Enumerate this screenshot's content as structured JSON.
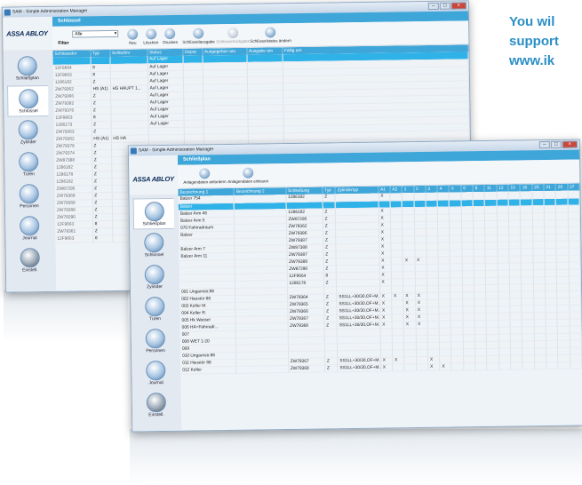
{
  "promo": {
    "lines": [
      "You wil",
      "support",
      "www.ik"
    ]
  },
  "back_window": {
    "title": "SAM - Simple Administration Manager",
    "logo": "ASSA ABLOY",
    "page_title": "Schlüssel",
    "filter": {
      "label": "Filter",
      "value": "Alle"
    },
    "toolbar": [
      {
        "label": "Neu",
        "enabled": true
      },
      {
        "label": "Löschen",
        "enabled": true
      },
      {
        "label": "Drucken",
        "enabled": true
      },
      {
        "label": "Schlüsselausgabe",
        "enabled": true
      },
      {
        "label": "Schlüsselrückgabe",
        "enabled": false
      },
      {
        "label": "Schlüsselstatus ändern",
        "enabled": true
      }
    ],
    "nav": [
      "Schließplan",
      "Schlüssel",
      "Zylinder",
      "Türen",
      "Personen",
      "Journal",
      "Einstell."
    ],
    "columns": [
      "Schlüsselnr",
      "Typ",
      "Schließnr",
      "Status",
      "Depot",
      "Ausgegeben am",
      "Ausgabe am",
      "Fällig am"
    ],
    "rows": [
      [
        "",
        "",
        "",
        "Auf Lager",
        "",
        "",
        "",
        ""
      ],
      [
        "12F9664",
        "8",
        "",
        "Auf Lager",
        "",
        "",
        "",
        ""
      ],
      [
        "12F9603",
        "8",
        "",
        "Auf Lager",
        "",
        "",
        "",
        ""
      ],
      [
        "1286182",
        "Z",
        "",
        "Auf Lager",
        "",
        "",
        "",
        ""
      ],
      [
        "ZW79362",
        "HS (A1)",
        "HS HAUPT 1...",
        "Auf Lager",
        "",
        "",
        "",
        ""
      ],
      [
        "ZW79366",
        "Z",
        "",
        "Auf Lager",
        "",
        "",
        "",
        ""
      ],
      [
        "ZW79392",
        "Z",
        "",
        "Auf Lager",
        "",
        "",
        "",
        ""
      ],
      [
        "ZW79376",
        "Z",
        "",
        "Auf Lager",
        "",
        "",
        "",
        ""
      ],
      [
        "12F9663",
        "8",
        "",
        "Auf Lager",
        "",
        "",
        "",
        ""
      ],
      [
        "1286173",
        "Z",
        "",
        "Auf Lager",
        "",
        "",
        "",
        ""
      ],
      [
        "ZW79363",
        "Z",
        "",
        "",
        "",
        "",
        "",
        ""
      ],
      [
        "ZW79362",
        "HS (A1)",
        "HS HA",
        "",
        "",
        "",
        "",
        ""
      ],
      [
        "ZW79378",
        "Z",
        "",
        "",
        "",
        "",
        "",
        ""
      ],
      [
        "ZW79374",
        "Z",
        "",
        "",
        "",
        "",
        "",
        ""
      ],
      [
        "ZW87388",
        "Z",
        "",
        "",
        "",
        "",
        "",
        ""
      ],
      [
        "1286182",
        "Z",
        "",
        "",
        "",
        "",
        "",
        ""
      ],
      [
        "1286178",
        "Z",
        "",
        "",
        "",
        "",
        "",
        ""
      ],
      [
        "1286182",
        "Z",
        "",
        "",
        "",
        "",
        "",
        ""
      ],
      [
        "ZW87295",
        "Z",
        "",
        "",
        "",
        "",
        "",
        ""
      ],
      [
        "ZW79369",
        "Z",
        "",
        "",
        "",
        "",
        "",
        ""
      ],
      [
        "ZW79368",
        "Z",
        "",
        "",
        "",
        "",
        "",
        ""
      ],
      [
        "ZW79388",
        "Z",
        "",
        "",
        "",
        "",
        "",
        ""
      ],
      [
        "ZW79390",
        "Z",
        "",
        "",
        "",
        "",
        "",
        ""
      ],
      [
        "12F9663",
        "8",
        "",
        "",
        "",
        "",
        "",
        ""
      ],
      [
        "ZW79361",
        "Z",
        "",
        "",
        "",
        "",
        "",
        ""
      ],
      [
        "12F9663",
        "8",
        "",
        "",
        "",
        "",
        "",
        ""
      ]
    ]
  },
  "front_window": {
    "title": "SAM - Simple Administration Manager",
    "logo": "ASSA ABLOY",
    "page_title": "Schließplan",
    "toolbar": [
      {
        "label": "Anlagendaten anfordern",
        "enabled": true
      },
      {
        "label": "Anlagendaten einlesen",
        "enabled": true
      }
    ],
    "nav": [
      "Schließplan",
      "Schlüssel",
      "Zylinder",
      "Türen",
      "Personen",
      "Journal",
      "Einstell."
    ],
    "columns": [
      "Bezeichnung 1",
      "Bezeichnung 2",
      "Schließung",
      "Typ",
      "Zylindertyp",
      "A1",
      "A2",
      "1",
      "2",
      "3",
      "4",
      "5",
      "6",
      "8",
      "11",
      "12",
      "15",
      "16",
      "20",
      "21",
      "26",
      "27"
    ],
    "rows": [
      {
        "cells": [
          "Balzer 754",
          "",
          "1286182",
          "Z",
          ""
        ],
        "marks": [
          "X"
        ]
      },
      {
        "cells": [
          "Balzer",
          "",
          "",
          "",
          ""
        ],
        "marks": [],
        "selected": true
      },
      {
        "cells": [
          "Balzer Arm 46",
          "",
          "1286182",
          "Z",
          ""
        ],
        "marks": [
          "X"
        ]
      },
      {
        "cells": [
          "Balzer Arm 5",
          "",
          "ZW87295",
          "Z",
          ""
        ],
        "marks": [
          "X"
        ]
      },
      {
        "cells": [
          "070 Fahrradraum",
          "",
          "ZW79362",
          "Z",
          ""
        ],
        "marks": [
          "X"
        ]
      },
      {
        "cells": [
          "Balzer",
          "",
          "ZW79386",
          "Z",
          ""
        ],
        "marks": [
          "X"
        ]
      },
      {
        "cells": [
          "",
          "",
          "ZW79387",
          "Z",
          ""
        ],
        "marks": [
          "X"
        ]
      },
      {
        "cells": [
          "Balzer Arm 7",
          "",
          "ZW87388",
          "Z",
          ""
        ],
        "marks": [
          "X"
        ]
      },
      {
        "cells": [
          "Balzer Arm 11",
          "",
          "ZW79387",
          "Z",
          ""
        ],
        "marks": [
          "X"
        ]
      },
      {
        "cells": [
          "",
          "",
          "ZW79389",
          "Z",
          ""
        ],
        "marks": [
          "X",
          "",
          "X",
          "X"
        ]
      },
      {
        "cells": [
          "",
          "",
          "ZW87290",
          "Z",
          ""
        ],
        "marks": [
          "X"
        ]
      },
      {
        "cells": [
          "",
          "",
          "12F9664",
          "8",
          ""
        ],
        "marks": [
          "X"
        ]
      },
      {
        "cells": [
          "",
          "",
          "1286178",
          "Z",
          ""
        ],
        "marks": [
          "X"
        ]
      },
      {
        "cells": [
          "001 Ungarnstr.88",
          "",
          "",
          "",
          ""
        ],
        "marks": []
      },
      {
        "cells": [
          "002 Haustür 88",
          "",
          "ZW79364",
          "Z",
          "SS1LL+30/30,OF+M..."
        ],
        "marks": [
          "X",
          "X",
          "X",
          "X"
        ]
      },
      {
        "cells": [
          "003 Keller M.",
          "",
          "ZW79365",
          "Z",
          "SS1LL+30/30,OF+M..."
        ],
        "marks": [
          "X",
          "",
          "X",
          "X"
        ]
      },
      {
        "cells": [
          "004 Keller R.",
          "",
          "ZW79366",
          "Z",
          "SS1LL+30/30,OF+M..."
        ],
        "marks": [
          "X",
          "",
          "X",
          "X"
        ]
      },
      {
        "cells": [
          "005 Hk Wasser",
          "",
          "ZW79367",
          "Z",
          "SS1LL+30/30,OF+M..."
        ],
        "marks": [
          "X",
          "",
          "X",
          "X"
        ]
      },
      {
        "cells": [
          "006 HA+Fahrradr...",
          "",
          "ZW79368",
          "Z",
          "SS1LL+30/30,OF+M..."
        ],
        "marks": [
          "X",
          "",
          "X",
          "X"
        ]
      },
      {
        "cells": [
          "007",
          "",
          "",
          "",
          ""
        ],
        "marks": []
      },
      {
        "cells": [
          "008 WET 1-20",
          "",
          "",
          "",
          ""
        ],
        "marks": []
      },
      {
        "cells": [
          "009",
          "",
          "",
          "",
          ""
        ],
        "marks": []
      },
      {
        "cells": [
          "010 Ungarnstr.88",
          "",
          "",
          "",
          ""
        ],
        "marks": []
      },
      {
        "cells": [
          "011 Haustür 88",
          "",
          "ZW79367",
          "Z",
          "SS1LL+30/30,OF+M..."
        ],
        "marks": [
          "X",
          "X",
          "",
          "",
          "X"
        ]
      },
      {
        "cells": [
          "012 Keller",
          "",
          "ZW79368",
          "Z",
          "SS1LL+30/30,OF+M..."
        ],
        "marks": [
          "X",
          "",
          "",
          "",
          "X",
          "X"
        ]
      }
    ]
  }
}
